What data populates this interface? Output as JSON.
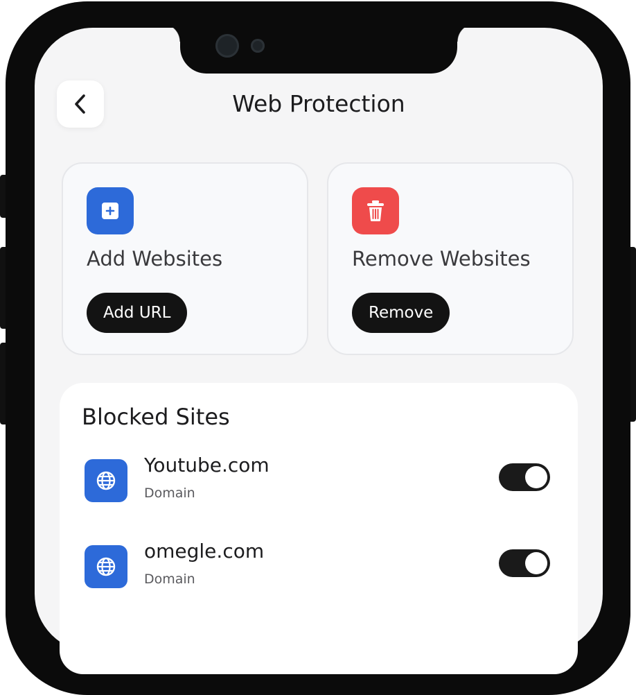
{
  "header": {
    "title": "Web Protection",
    "back_icon": "chevron-left-icon"
  },
  "actions": {
    "add": {
      "heading": "Add Websites",
      "button_label": "Add URL",
      "icon": "add-square-icon",
      "color": "#2d6ad9"
    },
    "remove": {
      "heading": "Remove Websites",
      "button_label": "Remove",
      "icon": "trash-icon",
      "color": "#ef4b4b"
    }
  },
  "blocked": {
    "title": "Blocked Sites",
    "items": [
      {
        "name": "Youtube.com",
        "type": "Domain",
        "icon": "globe-icon",
        "enabled": true
      },
      {
        "name": "omegle.com",
        "type": "Domain",
        "icon": "globe-icon",
        "enabled": true
      }
    ]
  }
}
